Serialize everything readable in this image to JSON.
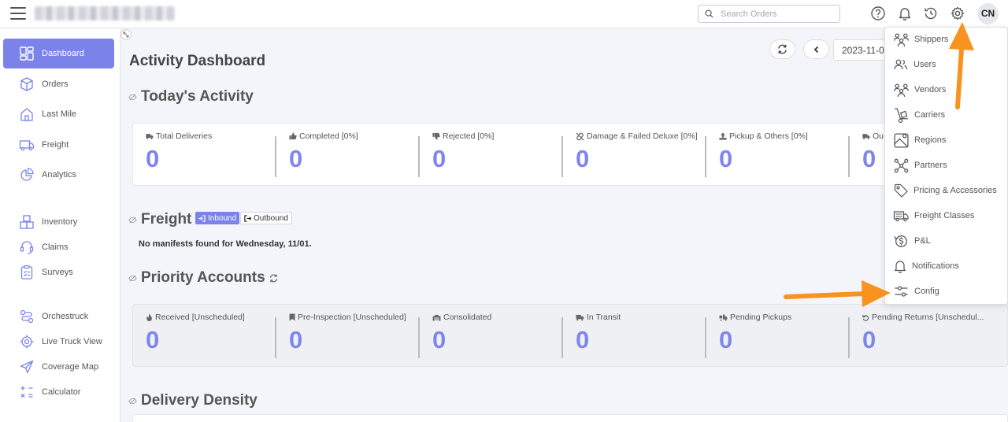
{
  "header": {
    "search_placeholder": "Search Orders",
    "avatar_initials": "CN"
  },
  "sidebar": {
    "items": [
      {
        "label": "Dashboard",
        "icon": "dashboard-icon",
        "active": true
      },
      {
        "label": "Orders",
        "icon": "box-icon"
      },
      {
        "label": "Last Mile",
        "icon": "house-icon"
      },
      {
        "label": "Freight",
        "icon": "truck-icon"
      },
      {
        "label": "Analytics",
        "icon": "pie-chart-icon"
      },
      {
        "label": "Inventory",
        "icon": "boxes-icon"
      },
      {
        "label": "Claims",
        "icon": "headset-icon"
      },
      {
        "label": "Surveys",
        "icon": "clipboard-icon"
      },
      {
        "label": "Orchestruck",
        "icon": "route-icon"
      },
      {
        "label": "Live Truck View",
        "icon": "target-icon"
      },
      {
        "label": "Coverage Map",
        "icon": "send-icon"
      },
      {
        "label": "Calculator",
        "icon": "calculator-icon"
      }
    ]
  },
  "main": {
    "title": "Activity Dashboard",
    "date": "2023-11-0",
    "todays_activity": {
      "title": "Today's Activity",
      "stats": [
        {
          "label": "Total Deliveries",
          "value": "0",
          "icon": "truck-icon"
        },
        {
          "label": "Completed [0%]",
          "value": "0",
          "icon": "thumbs-up-icon"
        },
        {
          "label": "Rejected [0%]",
          "value": "0",
          "icon": "thumbs-down-icon"
        },
        {
          "label": "Damage & Failed Deluxe [0%]",
          "value": "0",
          "icon": "unlink-icon"
        },
        {
          "label": "Pickup & Others [0%]",
          "value": "0",
          "icon": "upload-icon"
        },
        {
          "label": "Ou",
          "value": "0",
          "icon": "truck-icon"
        }
      ]
    },
    "freight": {
      "title": "Freight",
      "inbound_label": "Inbound",
      "outbound_label": "Outbound",
      "message": "No manifests found for Wednesday, 11/01."
    },
    "priority_accounts": {
      "title": "Priority Accounts",
      "stats": [
        {
          "label": "Received [Unscheduled]",
          "value": "0",
          "icon": "fire-icon"
        },
        {
          "label": "Pre-Inspection [Unscheduled]",
          "value": "0",
          "icon": "bookmark-icon"
        },
        {
          "label": "Consolidated",
          "value": "0",
          "icon": "warehouse-icon"
        },
        {
          "label": "In Transit",
          "value": "0",
          "icon": "truck-icon"
        },
        {
          "label": "Pending Pickups",
          "value": "0",
          "icon": "truck-loading-icon"
        },
        {
          "label": "Pending Returns [Unschedul...",
          "value": "0",
          "icon": "undo-icon"
        }
      ]
    },
    "delivery_density": {
      "title": "Delivery Density"
    }
  },
  "settings_menu": {
    "items": [
      {
        "label": "Shippers",
        "icon": "people-group-icon"
      },
      {
        "label": "Users",
        "icon": "users-icon"
      },
      {
        "label": "Vendors",
        "icon": "people-group-icon"
      },
      {
        "label": "Carriers",
        "icon": "hand-truck-icon"
      },
      {
        "label": "Regions",
        "icon": "map-icon"
      },
      {
        "label": "Partners",
        "icon": "network-icon"
      },
      {
        "label": "Pricing & Accessories",
        "icon": "tag-icon"
      },
      {
        "label": "Freight Classes",
        "icon": "truck-icon"
      },
      {
        "label": "P&L",
        "icon": "dollar-cycle-icon"
      },
      {
        "label": "Notifications",
        "icon": "bell-icon"
      },
      {
        "label": "Config",
        "icon": "sliders-icon"
      }
    ]
  },
  "colors": {
    "accent": "#7b83ea",
    "stat_value": "#7e86ee",
    "annotation_arrow": "#f7931e"
  }
}
